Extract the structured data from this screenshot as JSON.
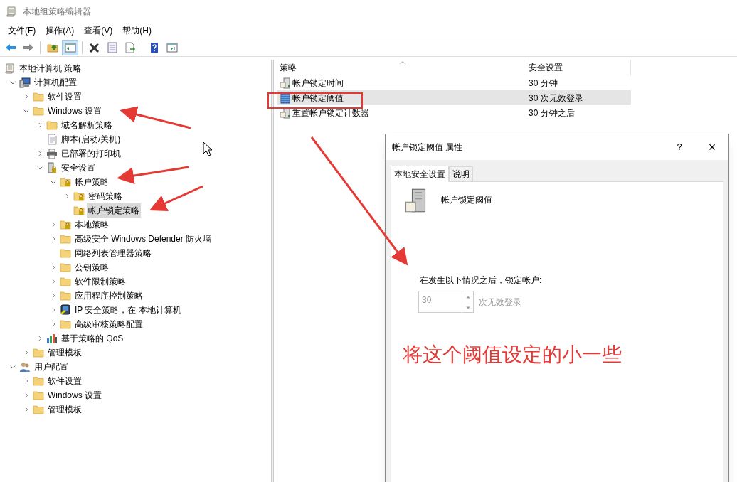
{
  "window": {
    "title": "本地组策略编辑器"
  },
  "menu": [
    "文件(F)",
    "操作(A)",
    "查看(V)",
    "帮助(H)"
  ],
  "toolbar": [
    {
      "kind": "back",
      "pressed": false
    },
    {
      "kind": "forward",
      "pressed": false
    },
    {
      "kind": "separator"
    },
    {
      "kind": "up",
      "pressed": false
    },
    {
      "kind": "tree",
      "pressed": true
    },
    {
      "kind": "separator"
    },
    {
      "kind": "delete",
      "pressed": false
    },
    {
      "kind": "properties",
      "pressed": false
    },
    {
      "kind": "export",
      "pressed": false
    },
    {
      "kind": "separator"
    },
    {
      "kind": "help",
      "pressed": false
    },
    {
      "kind": "pane",
      "pressed": false
    }
  ],
  "tree": [
    {
      "label": "本地计算机 策略",
      "kind": "policy",
      "selected": false,
      "children": [
        {
          "label": "计算机配置",
          "kind": "computer",
          "expandable": true,
          "expanded": true,
          "selected": false,
          "children": [
            {
              "label": "软件设置",
              "kind": "folder",
              "expandable": true,
              "expanded": false,
              "selected": false
            },
            {
              "label": "Windows 设置",
              "kind": "folder",
              "expandable": true,
              "expanded": true,
              "selected": false,
              "children": [
                {
                  "label": "域名解析策略",
                  "kind": "folder",
                  "expandable": true,
                  "expanded": false,
                  "selected": false
                },
                {
                  "label": "脚本(启动/关机)",
                  "kind": "script",
                  "selected": false
                },
                {
                  "label": "已部署的打印机",
                  "kind": "printer",
                  "expandable": true,
                  "expanded": false,
                  "selected": false
                },
                {
                  "label": "安全设置",
                  "kind": "security",
                  "expandable": true,
                  "expanded": true,
                  "selected": false,
                  "children": [
                    {
                      "label": "帐户策略",
                      "kind": "lockfolder",
                      "expandable": true,
                      "expanded": true,
                      "selected": false,
                      "children": [
                        {
                          "label": "密码策略",
                          "kind": "lockfolder",
                          "expandable": true,
                          "expanded": false,
                          "selected": false
                        },
                        {
                          "label": "帐户锁定策略",
                          "kind": "lockfolder",
                          "selected": true
                        }
                      ]
                    },
                    {
                      "label": "本地策略",
                      "kind": "lockfolder",
                      "expandable": true,
                      "expanded": false,
                      "selected": false
                    },
                    {
                      "label": "高级安全 Windows Defender 防火墙",
                      "kind": "folder",
                      "expandable": true,
                      "expanded": false,
                      "selected": false
                    },
                    {
                      "label": "网络列表管理器策略",
                      "kind": "folder",
                      "selected": false
                    },
                    {
                      "label": "公钥策略",
                      "kind": "folder",
                      "expandable": true,
                      "expanded": false,
                      "selected": false
                    },
                    {
                      "label": "软件限制策略",
                      "kind": "folder",
                      "expandable": true,
                      "expanded": false,
                      "selected": false
                    },
                    {
                      "label": "应用程序控制策略",
                      "kind": "folder",
                      "expandable": true,
                      "expanded": false,
                      "selected": false
                    },
                    {
                      "label": "IP 安全策略，在 本地计算机",
                      "kind": "ip",
                      "expandable": true,
                      "expanded": false,
                      "selected": false
                    },
                    {
                      "label": "高级审核策略配置",
                      "kind": "folder",
                      "expandable": true,
                      "expanded": false,
                      "selected": false
                    }
                  ]
                },
                {
                  "label": "基于策略的 QoS",
                  "kind": "chart",
                  "expandable": true,
                  "expanded": false,
                  "selected": false
                }
              ]
            },
            {
              "label": "管理模板",
              "kind": "folder",
              "expandable": true,
              "expanded": false,
              "selected": false
            }
          ]
        },
        {
          "label": "用户配置",
          "kind": "user",
          "expandable": true,
          "expanded": true,
          "selected": false,
          "children": [
            {
              "label": "软件设置",
              "kind": "folder",
              "expandable": true,
              "expanded": false,
              "selected": false
            },
            {
              "label": "Windows 设置",
              "kind": "folder",
              "expandable": true,
              "expanded": false,
              "selected": false
            },
            {
              "label": "管理模板",
              "kind": "folder",
              "expandable": true,
              "expanded": false,
              "selected": false
            }
          ]
        }
      ]
    }
  ],
  "table": {
    "columns": [
      "策略",
      "安全设置"
    ],
    "rows": [
      {
        "policy": "帐户锁定时间",
        "setting": "30 分钟",
        "kind": "plain",
        "selected": false
      },
      {
        "policy": "帐户锁定阈值",
        "setting": "30 次无效登录",
        "kind": "blue",
        "selected": true
      },
      {
        "policy": "重置帐户锁定计数器",
        "setting": "30 分钟之后",
        "kind": "plain",
        "selected": false
      }
    ]
  },
  "dialog": {
    "title": "帐户锁定阈值 属性",
    "help": "?",
    "close": "×",
    "tabs": [
      {
        "label": "本地安全设置",
        "selected": true
      },
      {
        "label": "说明",
        "selected": false
      }
    ],
    "policy_name": "帐户锁定阈值",
    "prompt": "在发生以下情况之后，锁定帐户:",
    "spin": {
      "value": "30",
      "unit": "次无效登录",
      "disabled": true
    }
  },
  "annotation": "将这个阈值设定的小一些"
}
